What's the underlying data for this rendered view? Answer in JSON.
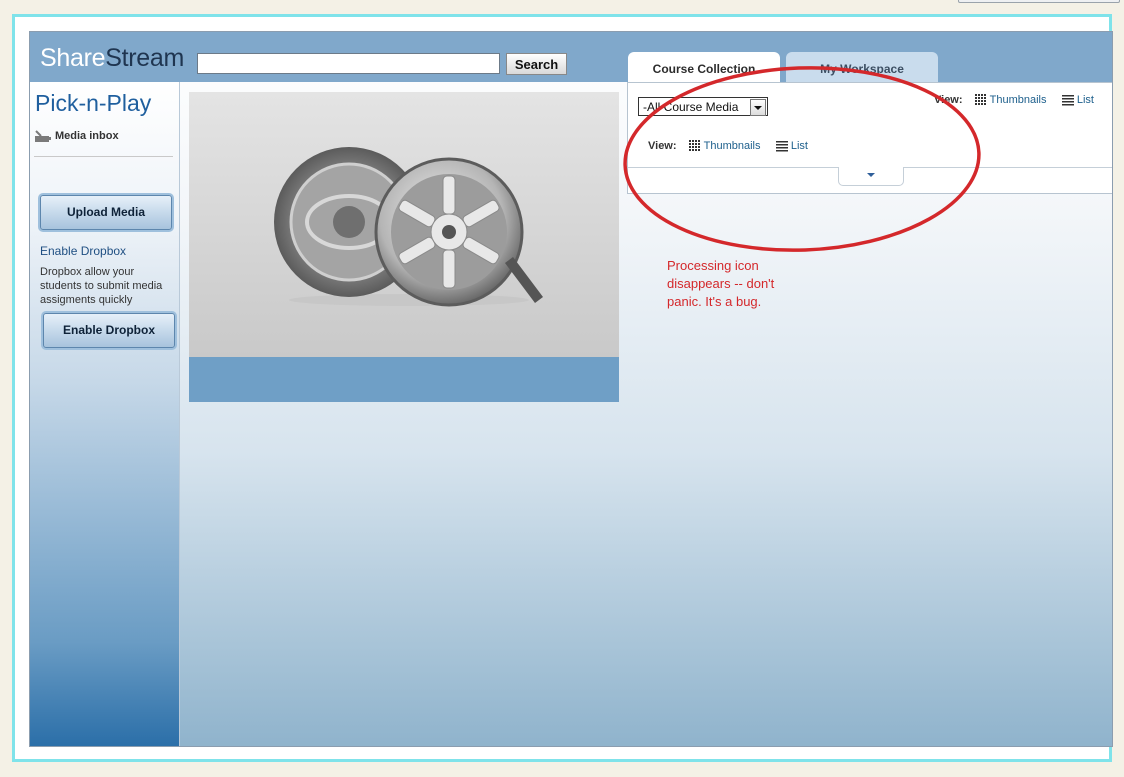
{
  "header": {
    "logo_part1": "Share",
    "logo_part2": "Stream",
    "search_value": "",
    "search_button": "Search"
  },
  "sidebar": {
    "title": "Pick-n-Play",
    "inbox_label": "Media inbox",
    "upload_button": "Upload Media",
    "enable_link": "Enable Dropbox",
    "dropbox_description": "Dropbox allow your students to submit media assigments quickly",
    "enable_button": "Enable Dropbox"
  },
  "tabs": [
    {
      "label": "Course Collection",
      "active": true
    },
    {
      "label": "My Workspace",
      "active": false
    }
  ],
  "collection": {
    "selected_filter": "-All Course Media",
    "view_label_top": "View:",
    "view_label": "View:",
    "thumbnails": "Thumbnails",
    "list": "List"
  },
  "annotation": {
    "text": "Processing icon disappears -- don't panic. It's a bug.",
    "color": "#d4282b"
  },
  "icons": [
    "inbox-icon",
    "media-reel-icon",
    "speaker-icon",
    "thumbnails-icon",
    "list-icon",
    "dropdown-arrow-icon",
    "expand-arrow-icon"
  ]
}
